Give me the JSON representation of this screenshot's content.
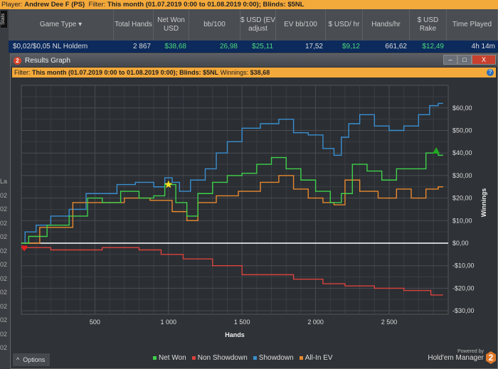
{
  "topbar": {
    "player_label": "Player:",
    "player": "Andrew Dee F (PS)",
    "filter_label": "Filter:",
    "filter": "This month (01.07.2019 0:00 to 01.08.2019 0:00); Blinds: $5NL"
  },
  "stats_tab": "Stats",
  "columns": [
    "Game Type ▾",
    "Total Hands",
    "Net Won USD",
    "bb/100",
    "$ USD (EV adjust",
    "EV bb/100",
    "$ USD/ hr",
    "Hands/hr",
    "$ USD Rake",
    "Time Played"
  ],
  "row": [
    "$0,02/$0,05 NL Holdem",
    "2 867",
    "$38,68",
    "26,98",
    "$25,11",
    "17,52",
    "$9,12",
    "661,62",
    "$12,49",
    "4h 14m"
  ],
  "left_bg": [
    "La",
    "02",
    "02",
    "02",
    "02",
    "02",
    "02",
    "02",
    "02",
    "02",
    "02",
    "02",
    "02"
  ],
  "window": {
    "title": "Results Graph",
    "min": "–",
    "max": "□",
    "close": "X",
    "filter_label": "Filter:",
    "filter": "This month (01.07.2019 0:00 to 01.08.2019 0:00); Blinds: $5NL",
    "winnings_label": "Winnings:",
    "winnings": "$38,68",
    "help": "?"
  },
  "options_label": "Options",
  "powered_by": "Powered by",
  "brand": "Hold'em Manager",
  "brand_num": "2",
  "chart_data": {
    "type": "line",
    "xlabel": "Hands",
    "ylabel": "Winnings",
    "xlim": [
      0,
      2900
    ],
    "ylim": [
      -30,
      65
    ],
    "x_ticks": [
      500,
      1000,
      1500,
      2000,
      2500
    ],
    "x_tick_labels": [
      "500",
      "1 000",
      "1 500",
      "2 000",
      "2 500"
    ],
    "y_ticks": [
      -30,
      -20,
      -10,
      0,
      10,
      20,
      30,
      40,
      50,
      60
    ],
    "y_tick_labels": [
      "-$30,00",
      "-$20,00",
      "-$10,00",
      "$0,00",
      "$10,00",
      "$20,00",
      "$30,00",
      "$40,00",
      "$50,00",
      "$60,00"
    ],
    "legend": "bottom-center",
    "series": [
      {
        "name": "Showdown",
        "color": "#3a8fd0",
        "points": [
          [
            0,
            0
          ],
          [
            50,
            5
          ],
          [
            150,
            8
          ],
          [
            250,
            12
          ],
          [
            400,
            15
          ],
          [
            480,
            22
          ],
          [
            600,
            22
          ],
          [
            700,
            26
          ],
          [
            850,
            27
          ],
          [
            950,
            25
          ],
          [
            1000,
            29
          ],
          [
            1050,
            27
          ],
          [
            1100,
            23
          ],
          [
            1200,
            28
          ],
          [
            1300,
            33
          ],
          [
            1350,
            40
          ],
          [
            1450,
            45
          ],
          [
            1550,
            51
          ],
          [
            1700,
            53
          ],
          [
            1800,
            55
          ],
          [
            1900,
            49
          ],
          [
            2000,
            48
          ],
          [
            2100,
            42
          ],
          [
            2150,
            39
          ],
          [
            2200,
            47
          ],
          [
            2250,
            53
          ],
          [
            2350,
            57
          ],
          [
            2450,
            52
          ],
          [
            2550,
            50
          ],
          [
            2650,
            52
          ],
          [
            2750,
            57
          ],
          [
            2800,
            61
          ],
          [
            2867,
            62
          ]
        ]
      },
      {
        "name": "All-In EV",
        "color": "#e8892e",
        "points": [
          [
            0,
            0
          ],
          [
            250,
            7
          ],
          [
            450,
            18
          ],
          [
            600,
            18
          ],
          [
            800,
            20
          ],
          [
            950,
            19
          ],
          [
            1100,
            14
          ],
          [
            1150,
            10
          ],
          [
            1250,
            18
          ],
          [
            1400,
            21
          ],
          [
            1550,
            23
          ],
          [
            1700,
            27
          ],
          [
            1800,
            30
          ],
          [
            1900,
            24
          ],
          [
            2000,
            20
          ],
          [
            2100,
            18
          ],
          [
            2150,
            17
          ],
          [
            2250,
            28
          ],
          [
            2350,
            23
          ],
          [
            2500,
            20
          ],
          [
            2600,
            24
          ],
          [
            2700,
            20
          ],
          [
            2800,
            24
          ],
          [
            2867,
            25
          ]
        ]
      },
      {
        "name": "Net Won",
        "color": "#3fd14a",
        "points": [
          [
            0,
            0
          ],
          [
            100,
            3
          ],
          [
            250,
            8
          ],
          [
            400,
            12
          ],
          [
            500,
            20
          ],
          [
            600,
            18
          ],
          [
            750,
            23
          ],
          [
            850,
            20
          ],
          [
            950,
            21
          ],
          [
            1000,
            26
          ],
          [
            1100,
            18
          ],
          [
            1150,
            12
          ],
          [
            1250,
            22
          ],
          [
            1350,
            27
          ],
          [
            1450,
            30
          ],
          [
            1550,
            31
          ],
          [
            1650,
            35
          ],
          [
            1750,
            38
          ],
          [
            1850,
            33
          ],
          [
            1950,
            28
          ],
          [
            2050,
            23
          ],
          [
            2150,
            18
          ],
          [
            2200,
            22
          ],
          [
            2300,
            35
          ],
          [
            2400,
            32
          ],
          [
            2500,
            28
          ],
          [
            2600,
            33
          ],
          [
            2700,
            33
          ],
          [
            2800,
            40
          ],
          [
            2867,
            39
          ]
        ]
      },
      {
        "name": "Non Showdown",
        "color": "#d9433c",
        "points": [
          [
            0,
            -2
          ],
          [
            100,
            -2
          ],
          [
            300,
            -3
          ],
          [
            500,
            -3
          ],
          [
            600,
            -2
          ],
          [
            700,
            -2
          ],
          [
            900,
            -3
          ],
          [
            1000,
            -5
          ],
          [
            1200,
            -7
          ],
          [
            1400,
            -10
          ],
          [
            1600,
            -14
          ],
          [
            1800,
            -14
          ],
          [
            1900,
            -16
          ],
          [
            2000,
            -16
          ],
          [
            2100,
            -18
          ],
          [
            2300,
            -19
          ],
          [
            2500,
            -20
          ],
          [
            2700,
            -21
          ],
          [
            2867,
            -23
          ]
        ]
      }
    ],
    "legend_order": [
      "Net Won",
      "Non Showdown",
      "Showdown",
      "All-In EV"
    ],
    "markers": [
      {
        "type": "heart",
        "x": 20,
        "y": -2,
        "color": "#e02020"
      },
      {
        "type": "star",
        "x": 1000,
        "y": 26,
        "color": "#f5e020"
      },
      {
        "type": "triangle",
        "x": 2820,
        "y": 41,
        "color": "#22aa22"
      }
    ]
  }
}
